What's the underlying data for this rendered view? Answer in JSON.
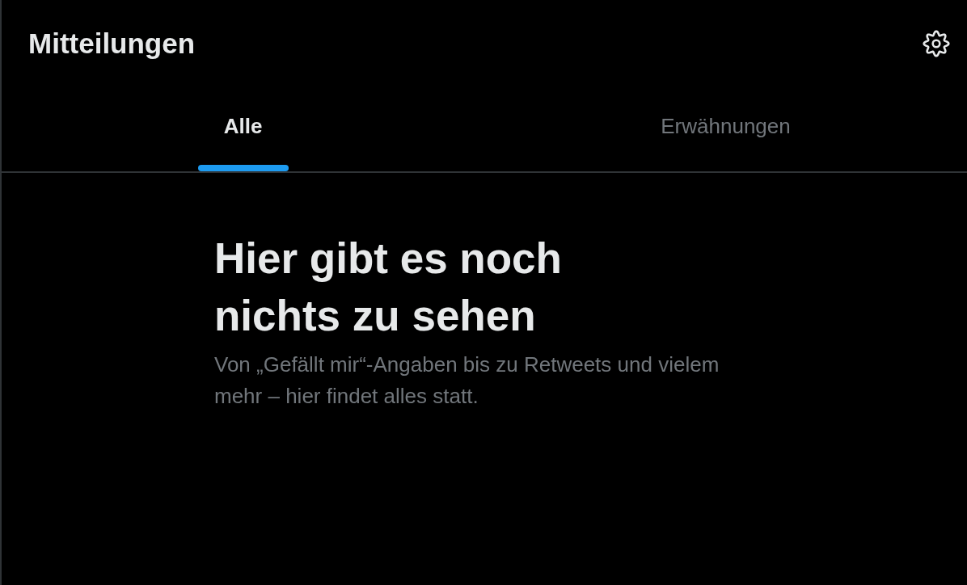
{
  "header": {
    "title": "Mitteilungen"
  },
  "tabs": [
    {
      "label": "Alle",
      "selected": true
    },
    {
      "label": "Erwähnungen",
      "selected": false
    }
  ],
  "empty_state": {
    "heading": "Hier gibt es noch nichts zu sehen",
    "text": "Von „Gefällt mir“-Angaben bis zu Retweets und vielem mehr – hier findet alles statt."
  }
}
